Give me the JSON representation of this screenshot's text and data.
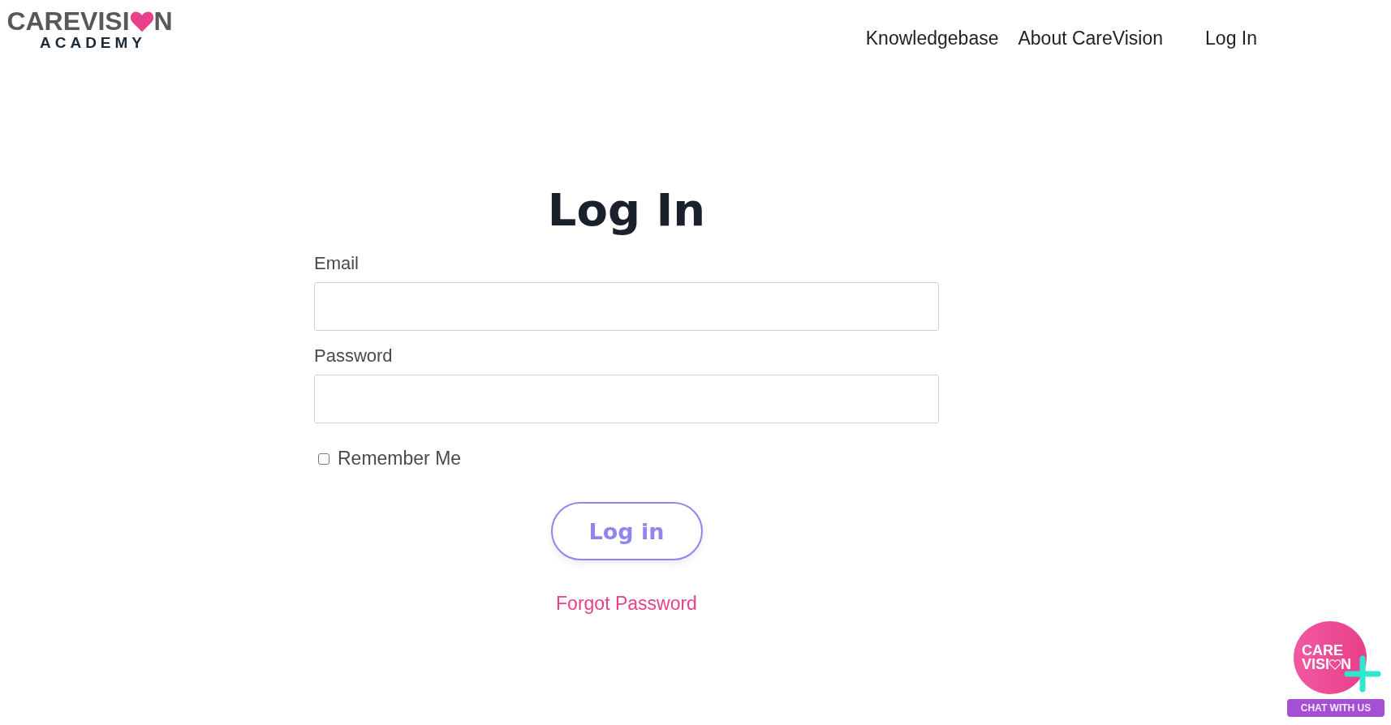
{
  "logo": {
    "word_before_heart": "CAREVISI",
    "word_after_heart": "N",
    "subtitle": "ACADEMY"
  },
  "nav": [
    {
      "label": "Knowledgebase"
    },
    {
      "label": "About CareVision"
    },
    {
      "label": "Log In"
    }
  ],
  "form": {
    "title": "Log In",
    "email_label": "Email",
    "password_label": "Password",
    "remember": {
      "label": "Remember Me",
      "checked": false
    },
    "submit": "Log in",
    "forgot": "Forgot Password"
  },
  "chat_widget": {
    "line1": "CARE",
    "line2_before_heart": "VISI",
    "line2_after_heart": "N",
    "button": "CHAT WITH US"
  }
}
